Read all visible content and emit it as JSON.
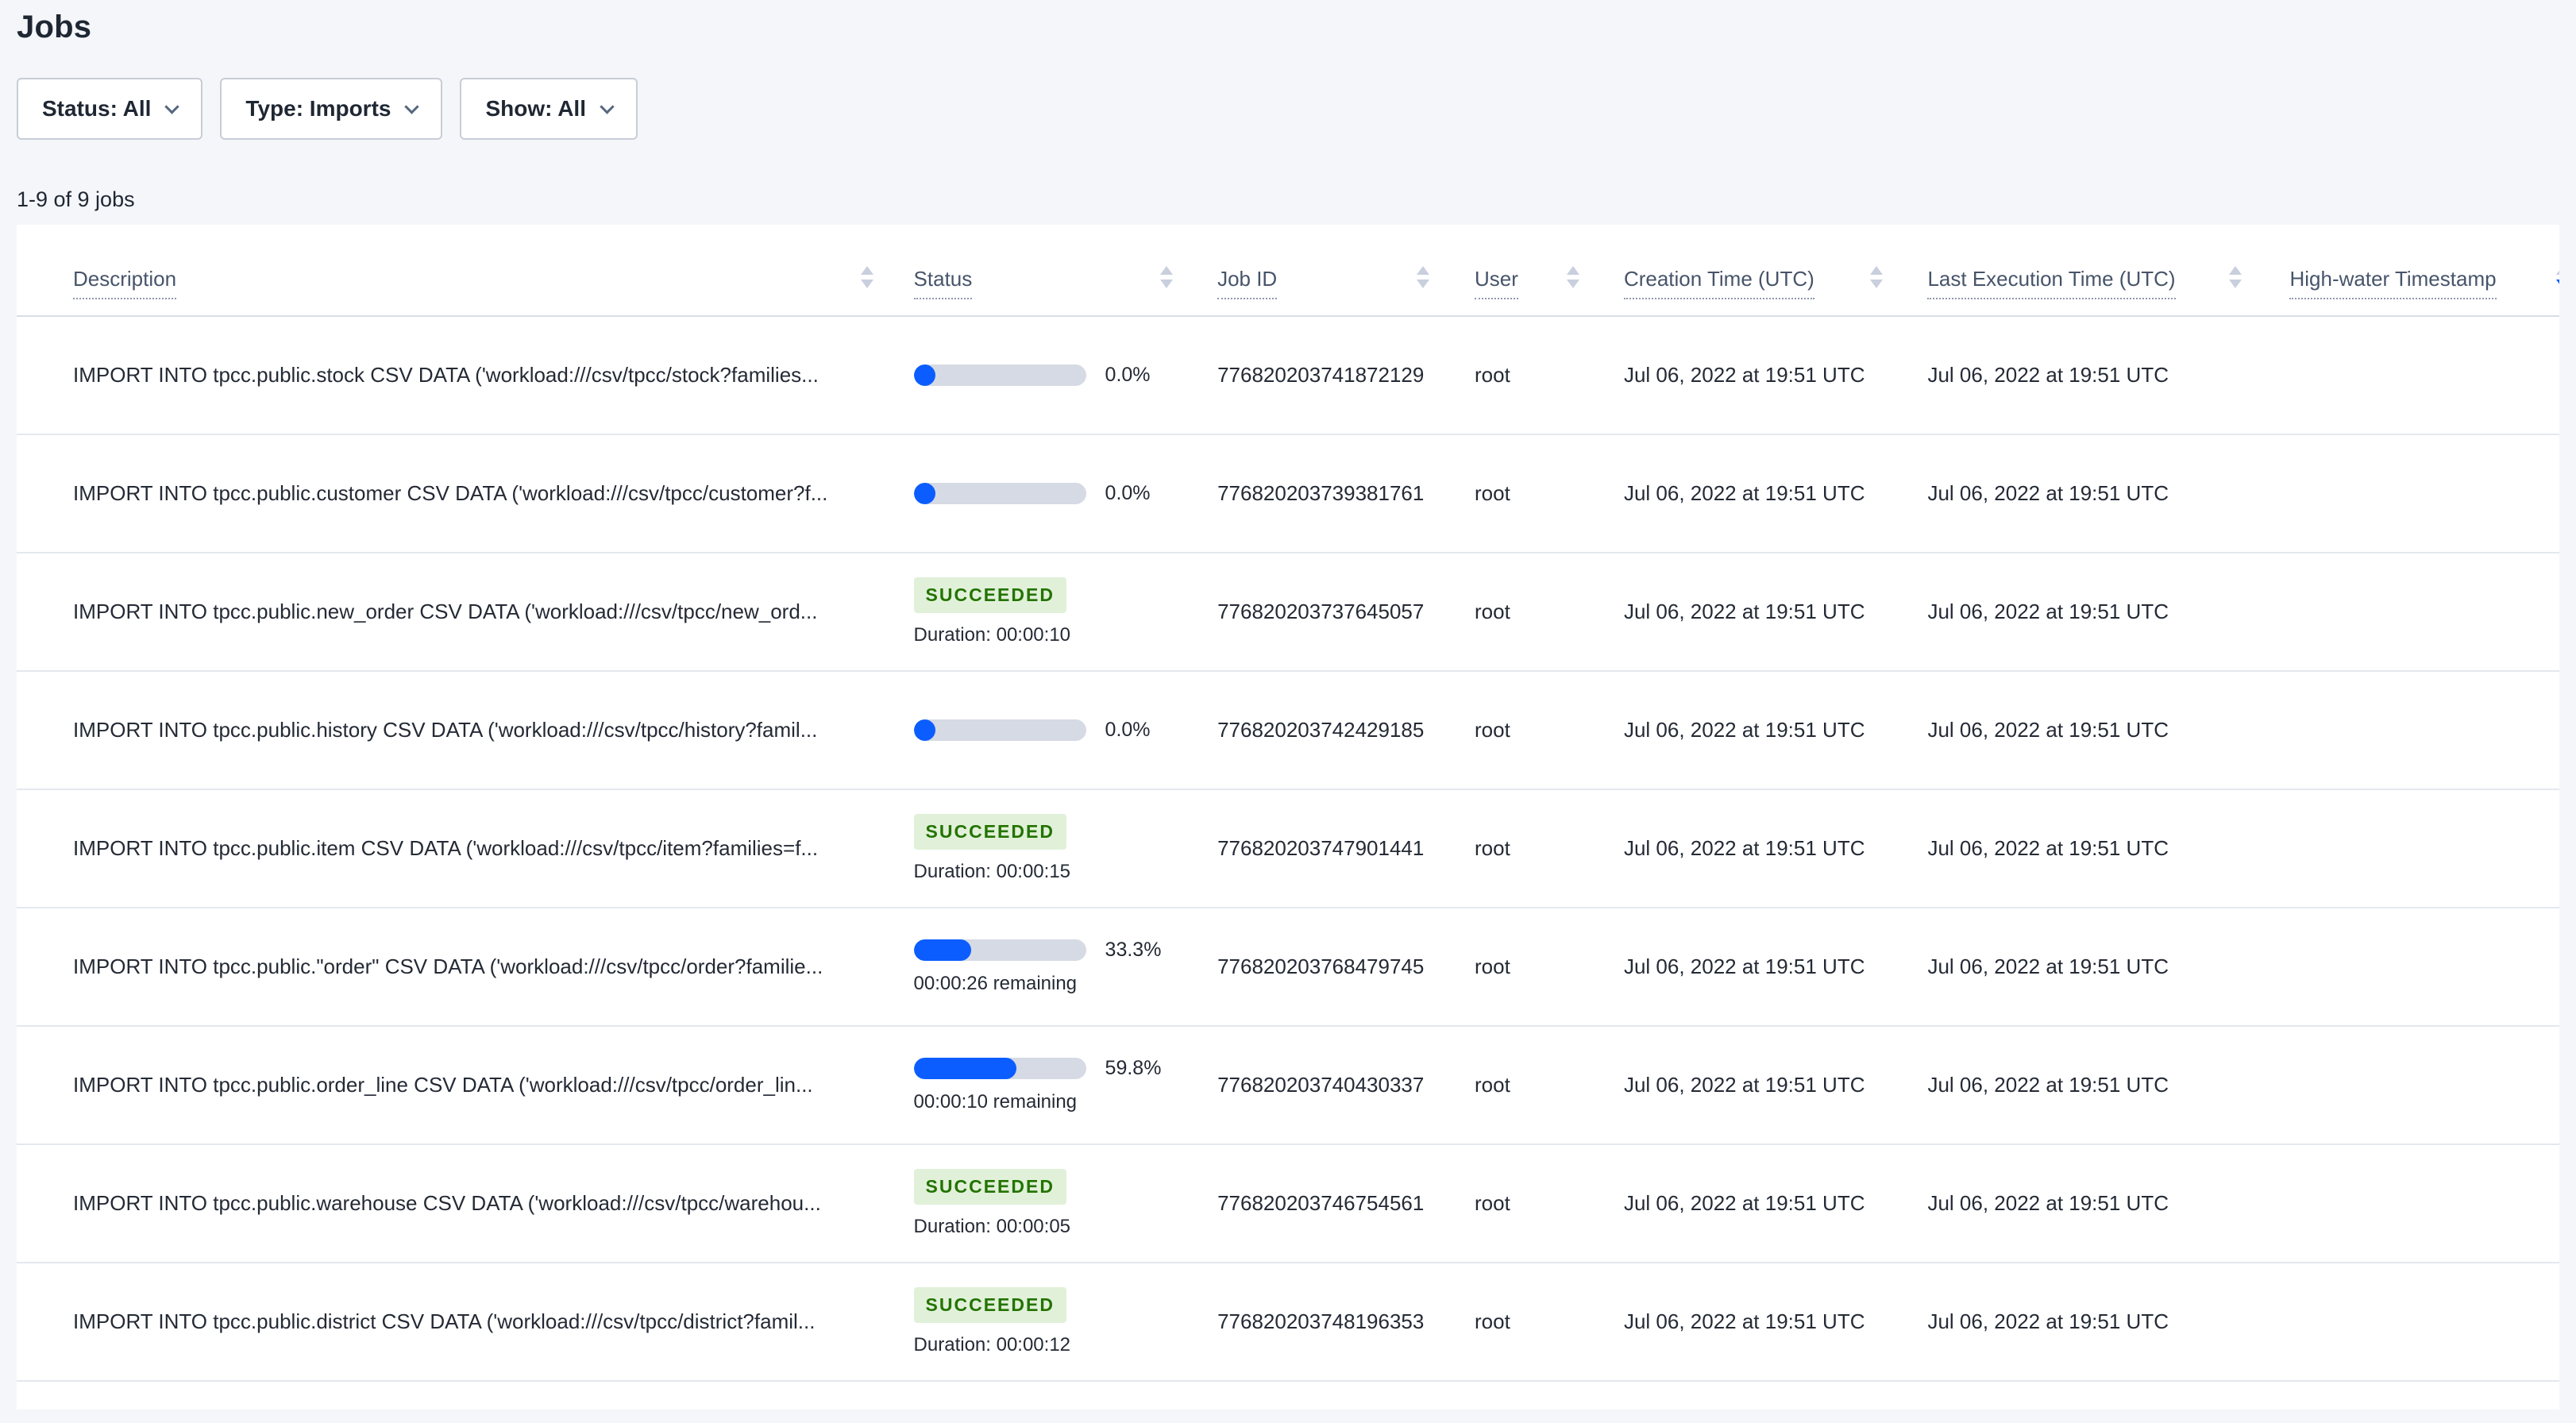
{
  "page": {
    "title": "Jobs"
  },
  "filters": [
    {
      "label": "Status: All"
    },
    {
      "label": "Type: Imports"
    },
    {
      "label": "Show: All"
    }
  ],
  "results_count": "1-9 of 9 jobs",
  "colors": {
    "accent_blue": "#0b5dff",
    "progress_track": "#d5dae4",
    "badge_green_bg": "#e1f1d9",
    "badge_green_text": "#237300"
  },
  "table": {
    "columns": [
      {
        "label": "Description",
        "sort": "none"
      },
      {
        "label": "Status",
        "sort": "none"
      },
      {
        "label": "Job ID",
        "sort": "none"
      },
      {
        "label": "User",
        "sort": "none"
      },
      {
        "label": "Creation Time (UTC)",
        "sort": "none"
      },
      {
        "label": "Last Execution Time (UTC)",
        "sort": "none"
      },
      {
        "label": "High-water Timestamp",
        "sort": "desc"
      }
    ],
    "rows": [
      {
        "description": "IMPORT INTO tpcc.public.stock CSV DATA ('workload:///csv/tpcc/stock?families...",
        "status": {
          "type": "progress",
          "percent_label": "0.0%",
          "fraction": "0%",
          "remaining": null
        },
        "job_id": "776820203741872129",
        "user": "root",
        "creation_time": "Jul 06, 2022 at 19:51 UTC",
        "last_execution_time": "Jul 06, 2022 at 19:51 UTC",
        "high_water": ""
      },
      {
        "description": "IMPORT INTO tpcc.public.customer CSV DATA ('workload:///csv/tpcc/customer?f...",
        "status": {
          "type": "progress",
          "percent_label": "0.0%",
          "fraction": "0%",
          "remaining": null
        },
        "job_id": "776820203739381761",
        "user": "root",
        "creation_time": "Jul 06, 2022 at 19:51 UTC",
        "last_execution_time": "Jul 06, 2022 at 19:51 UTC",
        "high_water": ""
      },
      {
        "description": "IMPORT INTO tpcc.public.new_order CSV DATA ('workload:///csv/tpcc/new_ord...",
        "status": {
          "type": "badge",
          "badge": "SUCCEEDED",
          "duration": "Duration: 00:00:10"
        },
        "job_id": "776820203737645057",
        "user": "root",
        "creation_time": "Jul 06, 2022 at 19:51 UTC",
        "last_execution_time": "Jul 06, 2022 at 19:51 UTC",
        "high_water": ""
      },
      {
        "description": "IMPORT INTO tpcc.public.history CSV DATA ('workload:///csv/tpcc/history?famil...",
        "status": {
          "type": "progress",
          "percent_label": "0.0%",
          "fraction": "0%",
          "remaining": null
        },
        "job_id": "776820203742429185",
        "user": "root",
        "creation_time": "Jul 06, 2022 at 19:51 UTC",
        "last_execution_time": "Jul 06, 2022 at 19:51 UTC",
        "high_water": ""
      },
      {
        "description": "IMPORT INTO tpcc.public.item CSV DATA ('workload:///csv/tpcc/item?families=f...",
        "status": {
          "type": "badge",
          "badge": "SUCCEEDED",
          "duration": "Duration: 00:00:15"
        },
        "job_id": "776820203747901441",
        "user": "root",
        "creation_time": "Jul 06, 2022 at 19:51 UTC",
        "last_execution_time": "Jul 06, 2022 at 19:51 UTC",
        "high_water": ""
      },
      {
        "description": "IMPORT INTO tpcc.public.\"order\" CSV DATA ('workload:///csv/tpcc/order?familie...",
        "status": {
          "type": "progress",
          "percent_label": "33.3%",
          "fraction": "33.3%",
          "remaining": "00:00:26 remaining"
        },
        "job_id": "776820203768479745",
        "user": "root",
        "creation_time": "Jul 06, 2022 at 19:51 UTC",
        "last_execution_time": "Jul 06, 2022 at 19:51 UTC",
        "high_water": ""
      },
      {
        "description": "IMPORT INTO tpcc.public.order_line CSV DATA ('workload:///csv/tpcc/order_lin...",
        "status": {
          "type": "progress",
          "percent_label": "59.8%",
          "fraction": "59.8%",
          "remaining": "00:00:10 remaining"
        },
        "job_id": "776820203740430337",
        "user": "root",
        "creation_time": "Jul 06, 2022 at 19:51 UTC",
        "last_execution_time": "Jul 06, 2022 at 19:51 UTC",
        "high_water": ""
      },
      {
        "description": "IMPORT INTO tpcc.public.warehouse CSV DATA ('workload:///csv/tpcc/warehou...",
        "status": {
          "type": "badge",
          "badge": "SUCCEEDED",
          "duration": "Duration: 00:00:05"
        },
        "job_id": "776820203746754561",
        "user": "root",
        "creation_time": "Jul 06, 2022 at 19:51 UTC",
        "last_execution_time": "Jul 06, 2022 at 19:51 UTC",
        "high_water": ""
      },
      {
        "description": "IMPORT INTO tpcc.public.district CSV DATA ('workload:///csv/tpcc/district?famil...",
        "status": {
          "type": "badge",
          "badge": "SUCCEEDED",
          "duration": "Duration: 00:00:12"
        },
        "job_id": "776820203748196353",
        "user": "root",
        "creation_time": "Jul 06, 2022 at 19:51 UTC",
        "last_execution_time": "Jul 06, 2022 at 19:51 UTC",
        "high_water": ""
      }
    ]
  }
}
